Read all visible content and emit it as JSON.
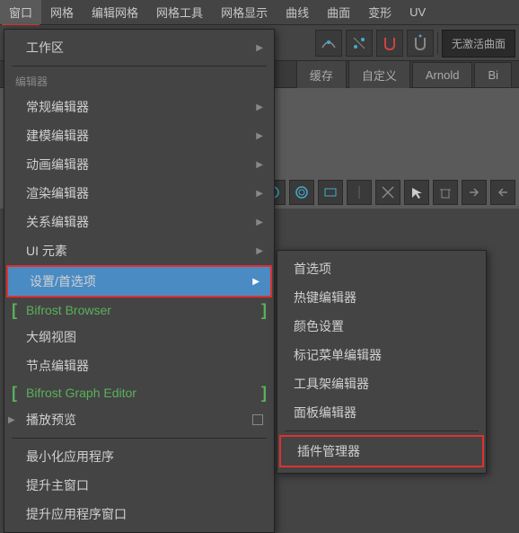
{
  "menubar": {
    "items": [
      "窗口",
      "网格",
      "编辑网格",
      "网格工具",
      "网格显示",
      "曲线",
      "曲面",
      "变形",
      "UV"
    ]
  },
  "toolbar": {
    "curve_label": "无激活曲面"
  },
  "tabs": {
    "items": [
      "缓存",
      "自定义",
      "Arnold",
      "Bi"
    ]
  },
  "menu": {
    "workspace": "工作区",
    "editors_header": "编辑器",
    "general_editors": "常规编辑器",
    "modeling_editors": "建模编辑器",
    "animation_editors": "动画编辑器",
    "rendering_editors": "渲染编辑器",
    "relationship_editors": "关系编辑器",
    "ui_elements": "UI 元素",
    "settings_prefs": "设置/首选项",
    "bifrost_browser": "Bifrost Browser",
    "outliner": "大纲视图",
    "node_editor": "节点编辑器",
    "bifrost_graph": "Bifrost Graph Editor",
    "playblast": "播放预览",
    "minimize_app": "最小化应用程序",
    "raise_main": "提升主窗口",
    "raise_app": "提升应用程序窗口"
  },
  "submenu": {
    "preferences": "首选项",
    "hotkey_editor": "热键编辑器",
    "color_settings": "颜色设置",
    "marking_menu_editor": "标记菜单编辑器",
    "shelf_editor": "工具架编辑器",
    "panel_editor": "面板编辑器",
    "plugin_manager": "插件管理器"
  }
}
